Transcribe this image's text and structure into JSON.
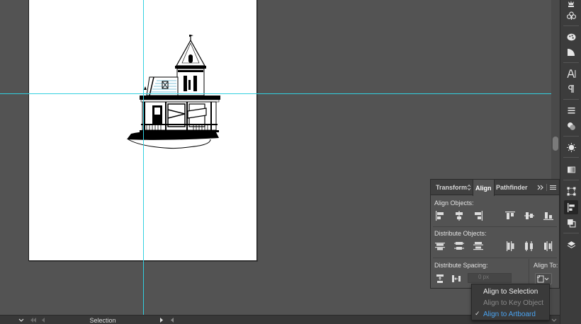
{
  "status_bar": {
    "tool_name": "Selection"
  },
  "align_panel": {
    "tabs": [
      {
        "label": "Transform"
      },
      {
        "label": "Align"
      },
      {
        "label": "Pathfinder"
      }
    ],
    "align_objects_label": "Align Objects:",
    "distribute_objects_label": "Distribute Objects:",
    "distribute_spacing_label": "Distribute Spacing:",
    "spacing_value": "0 px",
    "align_to_label": "Align To:"
  },
  "align_to_menu": {
    "items": [
      {
        "label": "Align to Selection",
        "state": "enabled",
        "checked": false
      },
      {
        "label": "Align to Key Object",
        "state": "disabled",
        "checked": false
      },
      {
        "label": "Align to Artboard",
        "state": "selected",
        "checked": true
      }
    ]
  },
  "colors": {
    "guide": "#32d0e0",
    "canvas": "#535353",
    "panel": "#535353",
    "selected_item": "#4aa3f0",
    "disabled_item": "#8a8a8a"
  },
  "icons": {
    "tool_strip": [
      "crown-icon",
      "club-icon",
      "palette-icon",
      "gradient-icon",
      "type-icon",
      "paragraph-icon",
      "stroke-icon",
      "transparency-icon",
      "appearance-icon",
      "swatch-gradient-icon",
      "transform-icon",
      "align-icon",
      "pathfinder-icon",
      "layers-icon"
    ]
  }
}
